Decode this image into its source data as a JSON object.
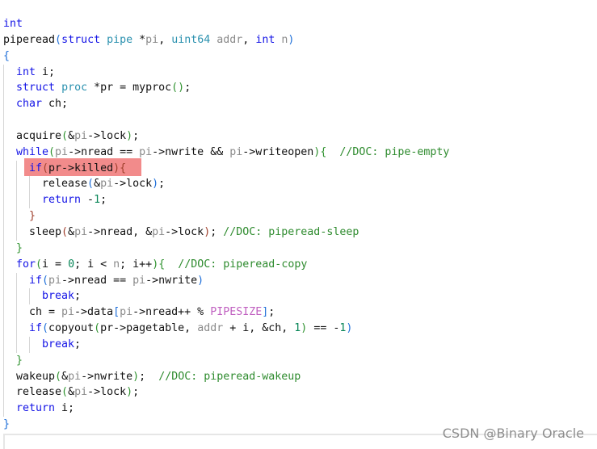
{
  "highlight_color": "#f28b8b",
  "highlighted_line": 11,
  "watermark": "CSDN @Binary Oracle",
  "code_lines": [
    {
      "indent": 0,
      "tokens": [
        [
          "int",
          "k"
        ]
      ]
    },
    {
      "indent": 0,
      "tokens": [
        [
          "piperead",
          ""
        ],
        [
          "(",
          "b1"
        ],
        [
          "struct",
          "k"
        ],
        [
          " ",
          ""
        ],
        [
          "pipe",
          "t"
        ],
        [
          " *",
          ""
        ],
        [
          "pi",
          "v"
        ],
        [
          ", ",
          ""
        ],
        [
          "uint64",
          "t"
        ],
        [
          " ",
          ""
        ],
        [
          "addr",
          "v"
        ],
        [
          ", ",
          ""
        ],
        [
          "int",
          "k"
        ],
        [
          " ",
          ""
        ],
        [
          "n",
          "v"
        ],
        [
          ")",
          "b1"
        ]
      ]
    },
    {
      "indent": 0,
      "tokens": [
        [
          "{",
          "b1"
        ]
      ]
    },
    {
      "indent": 1,
      "tokens": [
        [
          "int",
          "k"
        ],
        [
          " i;",
          ""
        ]
      ]
    },
    {
      "indent": 1,
      "tokens": [
        [
          "struct",
          "k"
        ],
        [
          " ",
          ""
        ],
        [
          "proc",
          "t"
        ],
        [
          " *pr = myproc",
          ""
        ],
        [
          "()",
          "b2"
        ],
        [
          ";",
          ""
        ]
      ]
    },
    {
      "indent": 1,
      "tokens": [
        [
          "char",
          "k"
        ],
        [
          " ch;",
          ""
        ]
      ]
    },
    {
      "indent": 1,
      "tokens": []
    },
    {
      "indent": 1,
      "tokens": [
        [
          "acquire",
          ""
        ],
        [
          "(",
          "b2"
        ],
        [
          "&",
          ""
        ],
        [
          "pi",
          "v"
        ],
        [
          "->lock",
          ""
        ],
        [
          ")",
          "b2"
        ],
        [
          ";",
          ""
        ]
      ]
    },
    {
      "indent": 1,
      "tokens": [
        [
          "while",
          "k"
        ],
        [
          "(",
          "b2"
        ],
        [
          "pi",
          "v"
        ],
        [
          "->nread == ",
          ""
        ],
        [
          "pi",
          "v"
        ],
        [
          "->nwrite && ",
          ""
        ],
        [
          "pi",
          "v"
        ],
        [
          "->writeopen",
          ""
        ],
        [
          ")",
          "b2"
        ],
        [
          "{",
          "b2"
        ],
        [
          "  //DOC: pipe-empty",
          "c"
        ]
      ]
    },
    {
      "indent": 2,
      "tokens": [
        [
          "if",
          "k"
        ],
        [
          "(",
          "b3"
        ],
        [
          "pr->killed",
          ""
        ],
        [
          ")",
          "b3"
        ],
        [
          "{",
          "b3"
        ]
      ]
    },
    {
      "indent": 3,
      "tokens": [
        [
          "release",
          ""
        ],
        [
          "(",
          "b1"
        ],
        [
          "&",
          ""
        ],
        [
          "pi",
          "v"
        ],
        [
          "->lock",
          ""
        ],
        [
          ")",
          "b1"
        ],
        [
          ";",
          ""
        ]
      ]
    },
    {
      "indent": 3,
      "tokens": [
        [
          "return",
          "k"
        ],
        [
          " -",
          ""
        ],
        [
          "1",
          "n"
        ],
        [
          ";",
          ""
        ]
      ]
    },
    {
      "indent": 2,
      "tokens": [
        [
          "}",
          "b3"
        ]
      ]
    },
    {
      "indent": 2,
      "tokens": [
        [
          "sleep",
          ""
        ],
        [
          "(",
          "b3"
        ],
        [
          "&",
          ""
        ],
        [
          "pi",
          "v"
        ],
        [
          "->nread, &",
          ""
        ],
        [
          "pi",
          "v"
        ],
        [
          "->lock",
          ""
        ],
        [
          ")",
          "b3"
        ],
        [
          "; ",
          ""
        ],
        [
          "//DOC: piperead-sleep",
          "c"
        ]
      ]
    },
    {
      "indent": 1,
      "tokens": [
        [
          "}",
          "b2"
        ]
      ]
    },
    {
      "indent": 1,
      "tokens": [
        [
          "for",
          "k"
        ],
        [
          "(",
          "b2"
        ],
        [
          "i = ",
          ""
        ],
        [
          "0",
          "n"
        ],
        [
          "; i < ",
          ""
        ],
        [
          "n",
          "v"
        ],
        [
          "; i++",
          ""
        ],
        [
          ")",
          "b2"
        ],
        [
          "{",
          "b2"
        ],
        [
          "  //DOC: piperead-copy",
          "c"
        ]
      ]
    },
    {
      "indent": 2,
      "tokens": [
        [
          "if",
          "k"
        ],
        [
          "(",
          "b1"
        ],
        [
          "pi",
          "v"
        ],
        [
          "->nread == ",
          ""
        ],
        [
          "pi",
          "v"
        ],
        [
          "->nwrite",
          ""
        ],
        [
          ")",
          "b1"
        ]
      ]
    },
    {
      "indent": 3,
      "tokens": [
        [
          "break",
          "k"
        ],
        [
          ";",
          ""
        ]
      ]
    },
    {
      "indent": 2,
      "tokens": [
        [
          "ch = ",
          ""
        ],
        [
          "pi",
          "v"
        ],
        [
          "->data",
          ""
        ],
        [
          "[",
          "b1"
        ],
        [
          "pi",
          "v"
        ],
        [
          "->nread++ % ",
          ""
        ],
        [
          "PIPESIZE",
          "m"
        ],
        [
          "]",
          "b1"
        ],
        [
          ";",
          ""
        ]
      ]
    },
    {
      "indent": 2,
      "tokens": [
        [
          "if",
          "k"
        ],
        [
          "(",
          "b1"
        ],
        [
          "copyout",
          ""
        ],
        [
          "(",
          "b2"
        ],
        [
          "pr->pagetable, ",
          ""
        ],
        [
          "addr",
          "v"
        ],
        [
          " + i, &ch, ",
          ""
        ],
        [
          "1",
          "n"
        ],
        [
          ")",
          "b2"
        ],
        [
          " == -",
          ""
        ],
        [
          "1",
          "n"
        ],
        [
          ")",
          "b1"
        ]
      ]
    },
    {
      "indent": 3,
      "tokens": [
        [
          "break",
          "k"
        ],
        [
          ";",
          ""
        ]
      ]
    },
    {
      "indent": 1,
      "tokens": [
        [
          "}",
          "b2"
        ]
      ]
    },
    {
      "indent": 1,
      "tokens": [
        [
          "wakeup",
          ""
        ],
        [
          "(",
          "b2"
        ],
        [
          "&",
          ""
        ],
        [
          "pi",
          "v"
        ],
        [
          "->nwrite",
          ""
        ],
        [
          ")",
          "b2"
        ],
        [
          ";  ",
          ""
        ],
        [
          "//DOC: piperead-wakeup",
          "c"
        ]
      ]
    },
    {
      "indent": 1,
      "tokens": [
        [
          "release",
          ""
        ],
        [
          "(",
          "b2"
        ],
        [
          "&",
          ""
        ],
        [
          "pi",
          "v"
        ],
        [
          "->lock",
          ""
        ],
        [
          ")",
          "b2"
        ],
        [
          ";",
          ""
        ]
      ]
    },
    {
      "indent": 1,
      "tokens": [
        [
          "return",
          "k"
        ],
        [
          " i;",
          ""
        ]
      ]
    },
    {
      "indent": 0,
      "tokens": [
        [
          "}",
          "b1"
        ]
      ]
    }
  ]
}
